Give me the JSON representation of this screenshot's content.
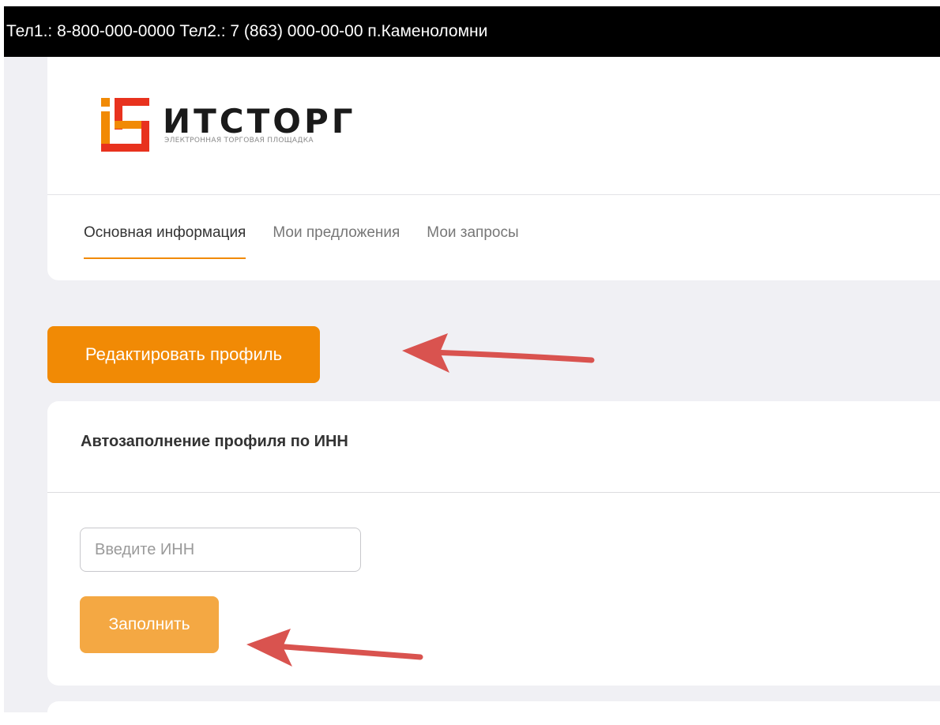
{
  "topbar": {
    "phones": "Тел1.: 8-800-000-0000  Тел2.: 7 (863) 000-00-00 п.Каменоломни"
  },
  "logo": {
    "word": "ИТСТОРГ",
    "subtitle": "ЭЛЕКТРОННАЯ ТОРГОВАЯ ПЛОЩАДКА",
    "colors": {
      "orange": "#f18a05",
      "red": "#e8321e",
      "dark": "#1a1a1a"
    }
  },
  "tabs": [
    {
      "label": "Основная информация",
      "active": true
    },
    {
      "label": "Мои предложения",
      "active": false
    },
    {
      "label": "Мои запросы",
      "active": false
    }
  ],
  "edit_profile": {
    "label": "Редактировать профиль"
  },
  "inn_card": {
    "title": "Автозаполнение профиля по ИНН",
    "input_value": "",
    "input_placeholder": "Введите ИНН",
    "fill_label": "Заполнить"
  },
  "annotations": {
    "arrow_icon": "arrow-left-icon",
    "arrow_color": "#d9534f"
  },
  "colors": {
    "accent": "#f18a05",
    "accent_light": "#f4a843",
    "page_bg": "#f0f0f4"
  }
}
